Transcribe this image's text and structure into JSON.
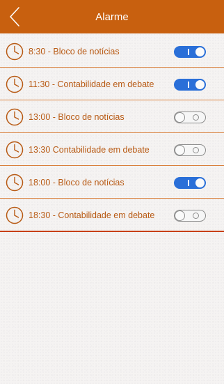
{
  "header": {
    "title": "Alarme",
    "back_icon": "chevron-left-icon",
    "background_color": "#c8600f",
    "title_color": "#ffffff"
  },
  "alarm_icon": "clock-icon",
  "accent_color": "#b85a14",
  "toggle_on_color": "#2a6fd8",
  "alarms": [
    {
      "label": "8:30 - Bloco de notícias",
      "enabled": true
    },
    {
      "label": "11:30 - Contabilidade em debate",
      "enabled": true
    },
    {
      "label": "13:00 - Bloco de notícias",
      "enabled": false
    },
    {
      "label": "13:30 Contabilidade em debate",
      "enabled": false
    },
    {
      "label": "18:00 - Bloco de notícias",
      "enabled": true
    },
    {
      "label": "18:30 - Contabilidade em debate",
      "enabled": false
    }
  ]
}
